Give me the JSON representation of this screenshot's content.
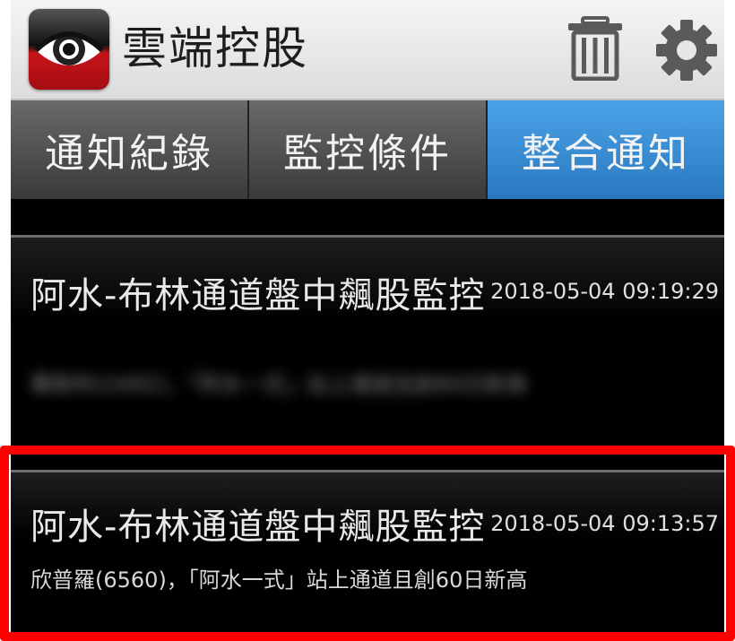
{
  "app": {
    "title": "雲端控股",
    "logo_icon": "eye-logo-icon",
    "actions": [
      {
        "icon": "trash-icon"
      },
      {
        "icon": "gear-icon"
      }
    ]
  },
  "tabs": [
    {
      "label": "通知紀錄",
      "active": false
    },
    {
      "label": "監控條件",
      "active": false
    },
    {
      "label": "整合通知",
      "active": true
    }
  ],
  "notifications": [
    {
      "title": "阿水-布林通道盤中飆股監控",
      "time": "2018-05-04 09:19:29",
      "message": "華新科(2492)，「阿水一式」站上通道且創60日新高",
      "message_blurred": true
    },
    {
      "title": "阿水-布林通道盤中飆股監控",
      "time": "2018-05-04 09:13:57",
      "message": "欣普羅(6560)，「阿水一式」站上通道且創60日新高",
      "message_blurred": false
    }
  ],
  "colors": {
    "accent_tab": "#2f86d2",
    "highlight_box": "#ff0000",
    "logo_red": "#c5141a"
  }
}
